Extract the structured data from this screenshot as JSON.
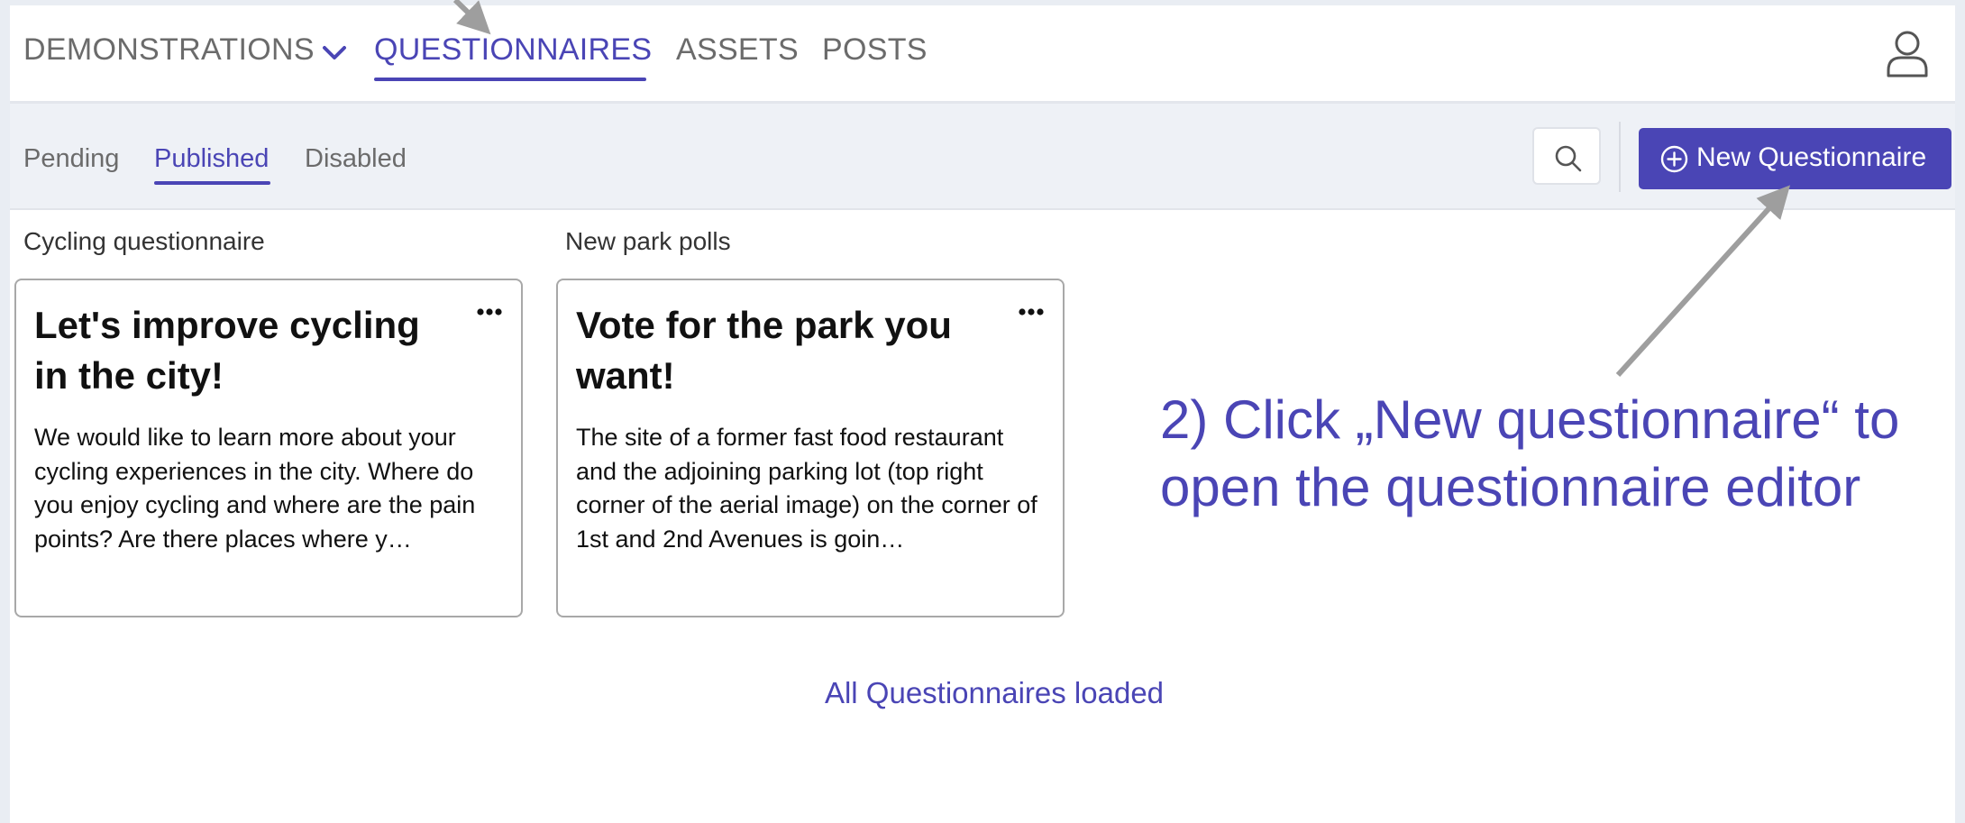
{
  "topnav": {
    "items": [
      {
        "label": "DEMONSTRATIONS",
        "has_dropdown": true
      },
      {
        "label": "QUESTIONNAIRES",
        "active": true
      },
      {
        "label": "ASSETS"
      },
      {
        "label": "POSTS"
      }
    ],
    "user_icon": "user-icon"
  },
  "subnav": {
    "tabs": [
      {
        "label": "Pending"
      },
      {
        "label": "Published",
        "active": true
      },
      {
        "label": "Disabled"
      }
    ],
    "search_icon": "search-icon",
    "new_button": {
      "label": "New Questionnaire",
      "icon": "plus-circle-icon"
    }
  },
  "groups": [
    {
      "label": "Cycling questionnaire",
      "card": {
        "title": "Let's improve cycling in the city!",
        "description": "We would like to learn more about your cycling experiences in the city. Where do you enjoy cycling and where are the pain points? Are there places where y…"
      }
    },
    {
      "label": "New park polls",
      "card": {
        "title": "Vote for the park you want!",
        "description": "The site of a former fast food restaurant and the adjoining parking lot (top right corner of the aerial image) on the corner of 1st and 2nd Avenues is goin…"
      }
    }
  ],
  "status": "All Questionnaires loaded",
  "annotation": {
    "line1": "2) Click „New questionnaire“ to",
    "line2": "open the questionnaire editor"
  },
  "colors": {
    "accent": "#4a45b5",
    "background": "#e9edf3",
    "annotation_arrow": "#9e9e9e"
  }
}
